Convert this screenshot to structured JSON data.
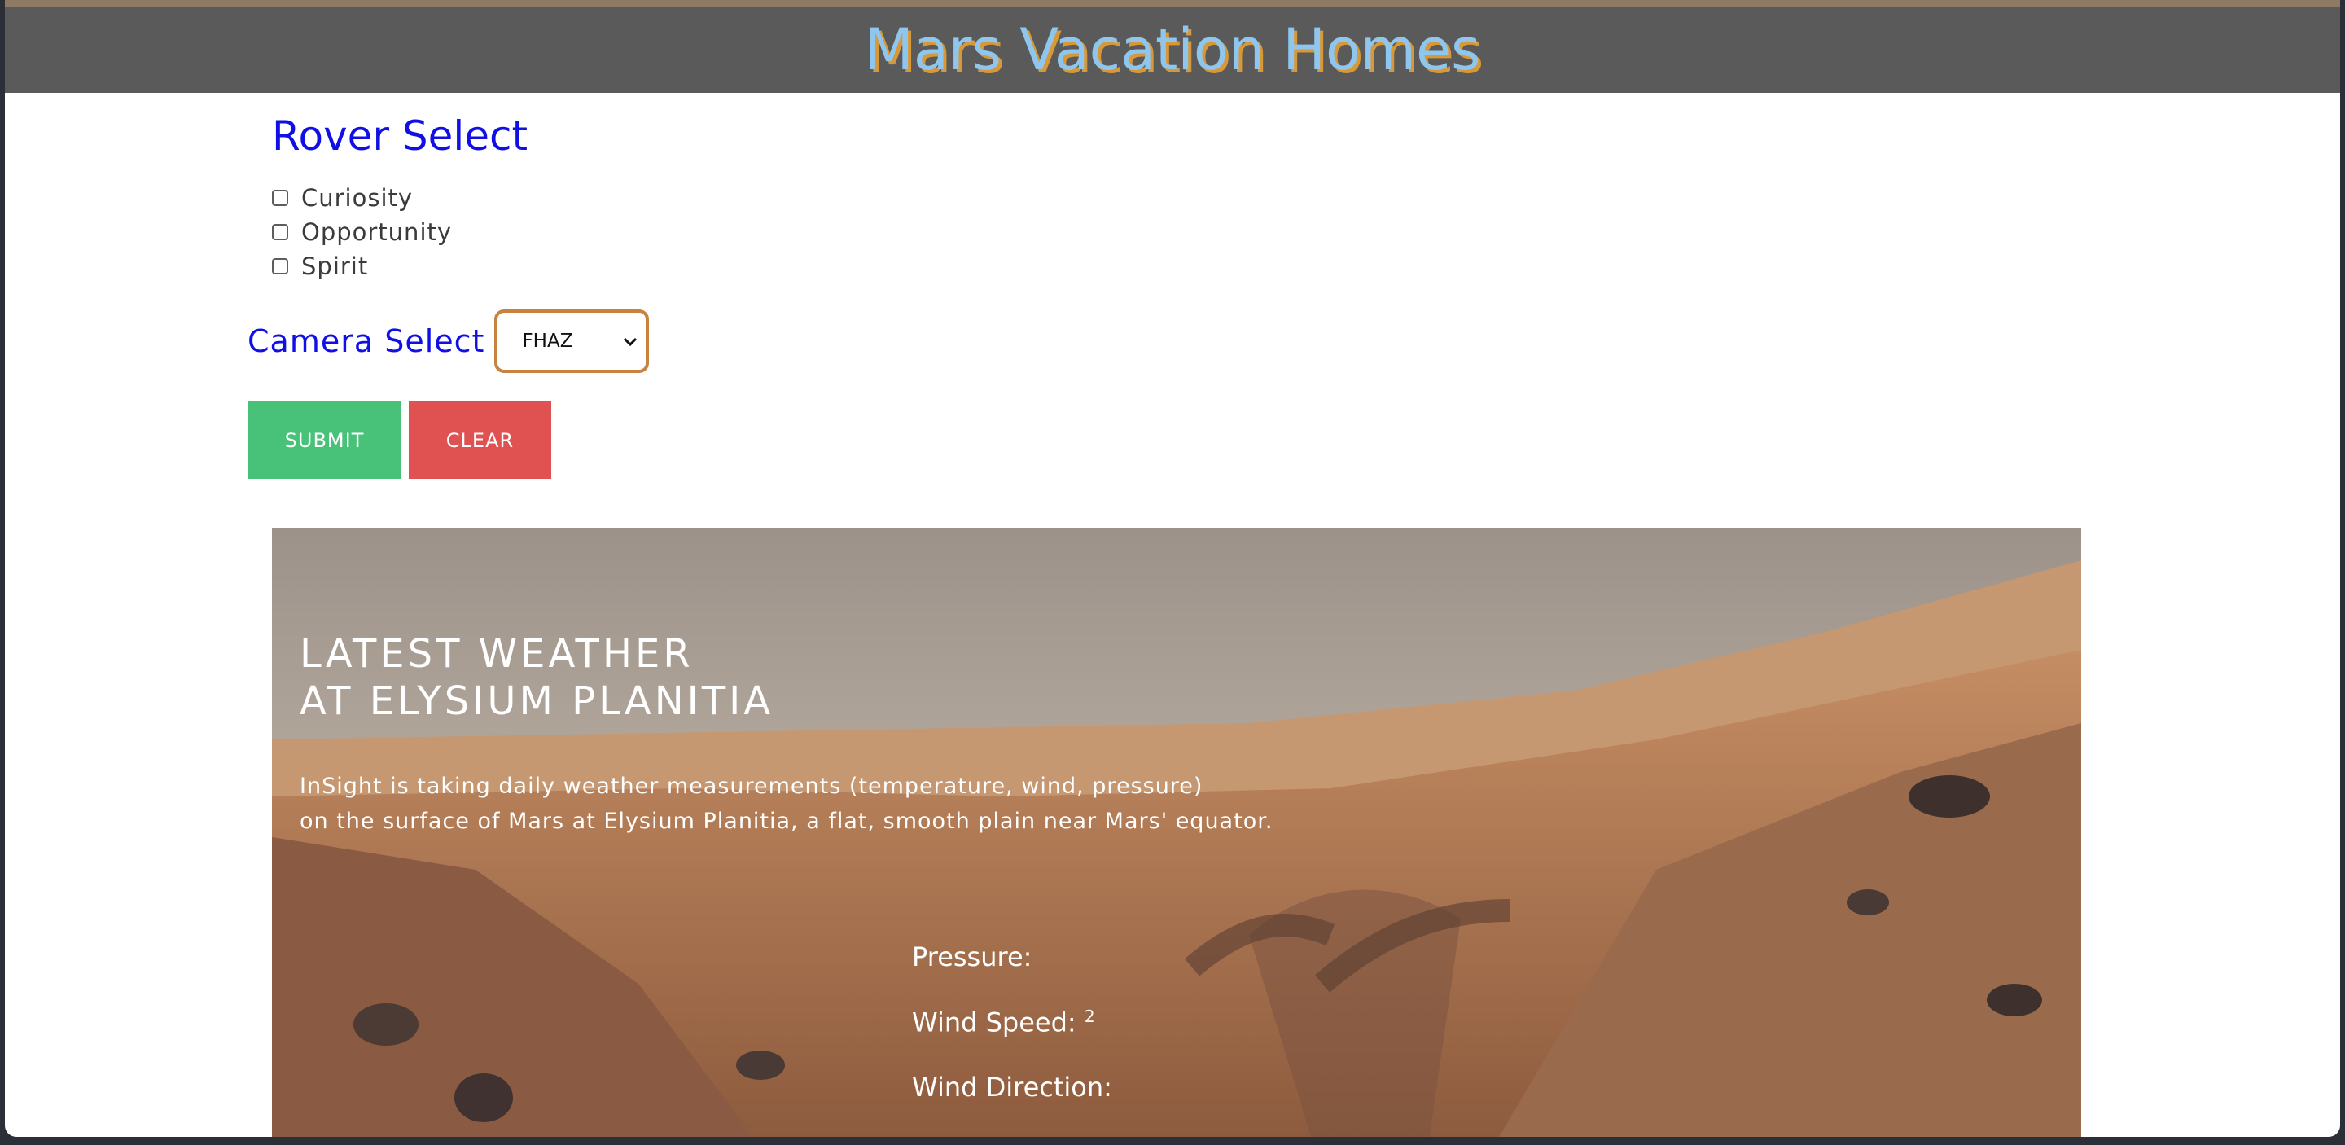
{
  "header": {
    "title": "Mars Vacation Homes"
  },
  "rover_select": {
    "heading": "Rover Select",
    "options": [
      {
        "label": "Curiosity",
        "checked": false
      },
      {
        "label": "Opportunity",
        "checked": false
      },
      {
        "label": "Spirit",
        "checked": false
      }
    ]
  },
  "camera_select": {
    "label": "Camera Select",
    "selected": "FHAZ"
  },
  "buttons": {
    "submit": "SUBMIT",
    "clear": "CLEAR"
  },
  "weather": {
    "title_line1": "LATEST WEATHER",
    "title_line2": "AT ELYSIUM PLANITIA",
    "desc_line1": "InSight is taking daily weather measurements (temperature, wind, pressure)",
    "desc_line2": "on the surface of Mars at Elysium Planitia, a flat, smooth plain near Mars' equator.",
    "pressure_label": "Pressure:",
    "wind_speed_label": "Wind Speed:",
    "wind_speed_sup": "2",
    "wind_direction_label": "Wind Direction:"
  },
  "icons": {
    "select_arrow": "chevron-down-icon"
  }
}
